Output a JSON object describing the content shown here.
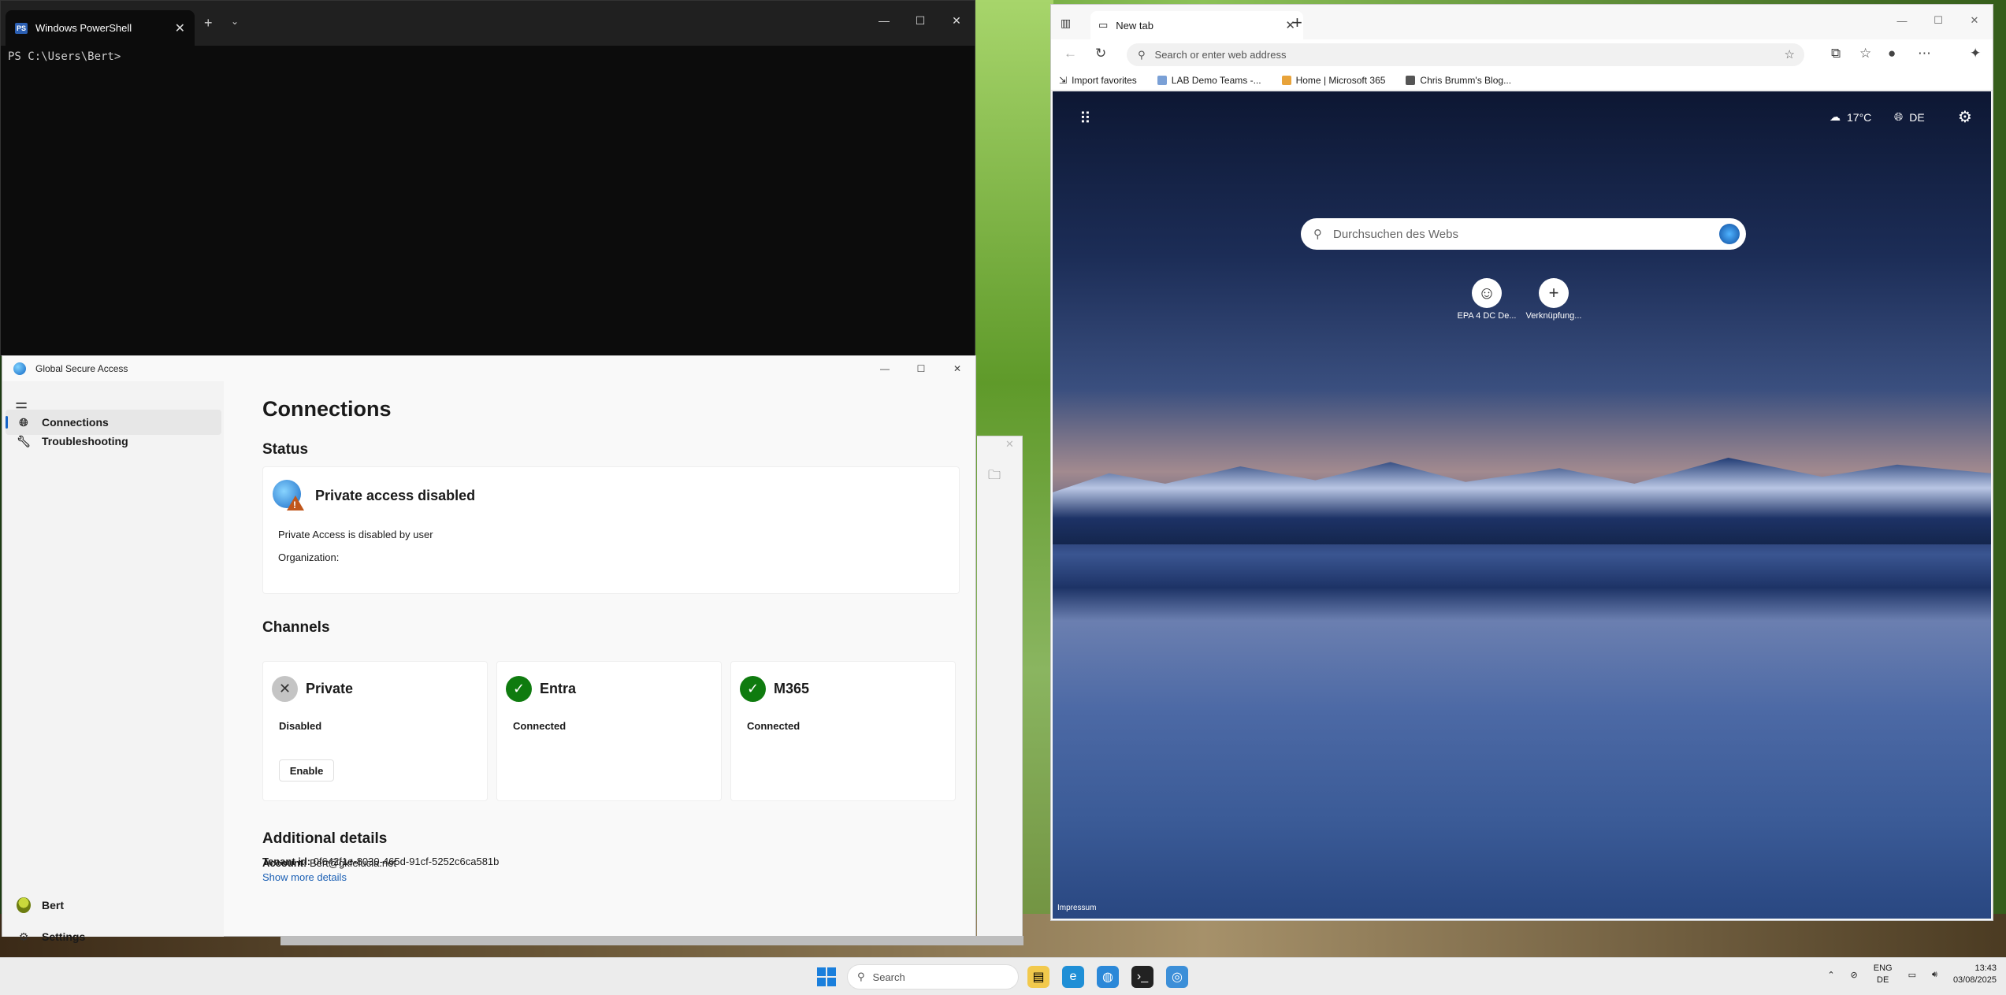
{
  "powershell": {
    "tab_title": "Windows PowerShell",
    "tab_icon": "ps-icon",
    "tab_icon_text": "PS",
    "new_tab": "+",
    "dropdown": "⌄",
    "prompt": "PS C:\\Users\\Bert>"
  },
  "gsa": {
    "window_title": "Global Secure Access",
    "nav": [
      {
        "label": "Connections",
        "icon": "globe-icon",
        "active": true
      },
      {
        "label": "Troubleshooting",
        "icon": "wrench-icon",
        "active": false
      }
    ],
    "user_label": "Bert",
    "settings_label": "Settings",
    "page_title": "Connections",
    "status_heading": "Status",
    "status": {
      "title": "Private access disabled",
      "line1": "Private Access is disabled by user",
      "line2": "Organization:"
    },
    "channels_heading": "Channels",
    "channels": [
      {
        "name": "Private",
        "state": "Disabled",
        "icon": "x-icon",
        "button": "Enable"
      },
      {
        "name": "Entra",
        "state": "Connected",
        "icon": "check-icon"
      },
      {
        "name": "M365",
        "state": "Connected",
        "icon": "check-icon"
      }
    ],
    "details_heading": "Additional details",
    "account_label": "Account:",
    "account_value": "Bert@gkfelucia.net",
    "tenant_label": "Tenant id:",
    "tenant_value": "0f642f1e-8030-465d-91cf-5252c6ca581b",
    "more_link": "Show more details"
  },
  "edge": {
    "tab_title": "New tab",
    "address_placeholder": "Search or enter web address",
    "favorites": [
      {
        "label": "Import favorites",
        "icon": "import-icon"
      },
      {
        "label": "LAB Demo Teams -...",
        "icon": "teams-icon"
      },
      {
        "label": "Home | Microsoft 365",
        "icon": "m365-icon"
      },
      {
        "label": "Chris Brumm's Blog...",
        "icon": "blog-icon"
      }
    ],
    "ntp": {
      "temperature": "17°C",
      "language": "DE",
      "search_placeholder": "Durchsuchen des Webs",
      "shortcuts": [
        {
          "label": "EPA 4 DC De..."
        },
        {
          "label": "Verknüpfung..."
        }
      ],
      "footer": "Impressum"
    }
  },
  "taskbar": {
    "search_label": "Search",
    "tray_lang_top": "ENG",
    "tray_lang_bottom": "DE",
    "time": "13:43",
    "date": "03/08/2025"
  },
  "colors": {
    "accent": "#1664c5",
    "connected_green": "#0f7b0f",
    "disabled_gray": "#c4c4c4",
    "warning": "#c0561c",
    "terminal_bg": "#0c0c0c"
  }
}
